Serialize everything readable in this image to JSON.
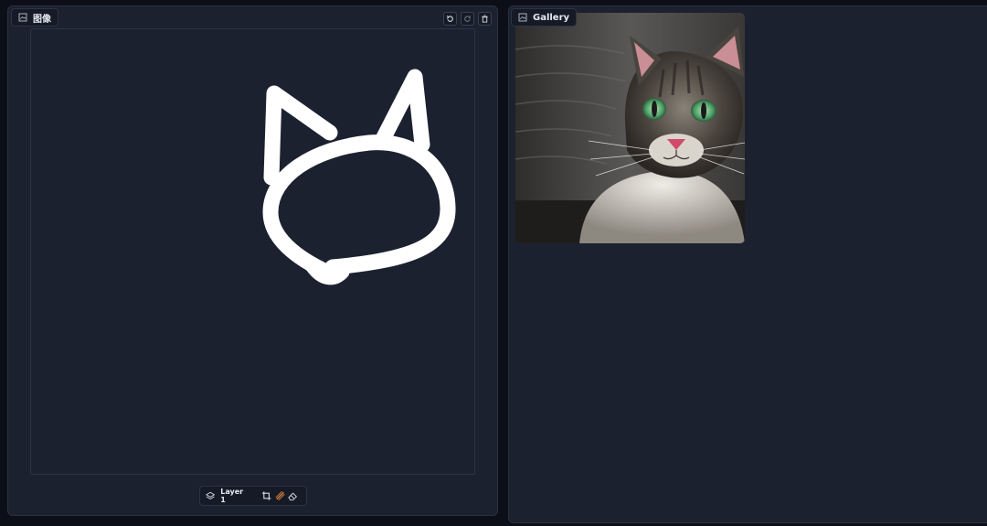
{
  "image_panel": {
    "title": "图像",
    "toolbar": [
      {
        "name": "undo",
        "icon": "undo-icon"
      },
      {
        "name": "redo",
        "icon": "redo-icon"
      },
      {
        "name": "clear",
        "icon": "trash-icon"
      }
    ],
    "layer_bar": {
      "layer_label": "Layer 1",
      "tools": [
        "crop-icon",
        "brush-icon",
        "eraser-icon"
      ]
    }
  },
  "gallery_panel": {
    "title": "Gallery"
  },
  "colors": {
    "panel_bg": "#1c2130",
    "page_bg": "#0c0f17",
    "border": "#2c3343",
    "stroke": "#ffffff",
    "brush_accent": "#e0803a"
  }
}
